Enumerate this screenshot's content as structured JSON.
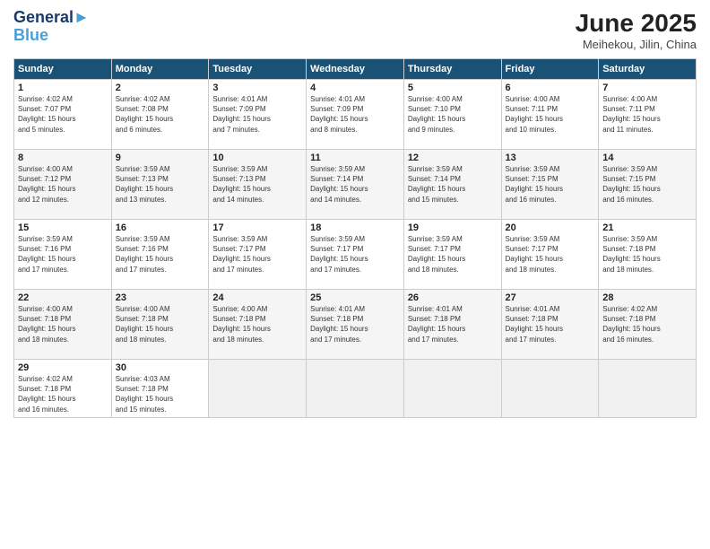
{
  "header": {
    "logo_line1": "General",
    "logo_line2": "Blue",
    "month": "June 2025",
    "location": "Meihekou, Jilin, China"
  },
  "weekdays": [
    "Sunday",
    "Monday",
    "Tuesday",
    "Wednesday",
    "Thursday",
    "Friday",
    "Saturday"
  ],
  "weeks": [
    [
      {
        "day": "1",
        "info": "Sunrise: 4:02 AM\nSunset: 7:07 PM\nDaylight: 15 hours\nand 5 minutes."
      },
      {
        "day": "2",
        "info": "Sunrise: 4:02 AM\nSunset: 7:08 PM\nDaylight: 15 hours\nand 6 minutes."
      },
      {
        "day": "3",
        "info": "Sunrise: 4:01 AM\nSunset: 7:09 PM\nDaylight: 15 hours\nand 7 minutes."
      },
      {
        "day": "4",
        "info": "Sunrise: 4:01 AM\nSunset: 7:09 PM\nDaylight: 15 hours\nand 8 minutes."
      },
      {
        "day": "5",
        "info": "Sunrise: 4:00 AM\nSunset: 7:10 PM\nDaylight: 15 hours\nand 9 minutes."
      },
      {
        "day": "6",
        "info": "Sunrise: 4:00 AM\nSunset: 7:11 PM\nDaylight: 15 hours\nand 10 minutes."
      },
      {
        "day": "7",
        "info": "Sunrise: 4:00 AM\nSunset: 7:11 PM\nDaylight: 15 hours\nand 11 minutes."
      }
    ],
    [
      {
        "day": "8",
        "info": "Sunrise: 4:00 AM\nSunset: 7:12 PM\nDaylight: 15 hours\nand 12 minutes."
      },
      {
        "day": "9",
        "info": "Sunrise: 3:59 AM\nSunset: 7:13 PM\nDaylight: 15 hours\nand 13 minutes."
      },
      {
        "day": "10",
        "info": "Sunrise: 3:59 AM\nSunset: 7:13 PM\nDaylight: 15 hours\nand 14 minutes."
      },
      {
        "day": "11",
        "info": "Sunrise: 3:59 AM\nSunset: 7:14 PM\nDaylight: 15 hours\nand 14 minutes."
      },
      {
        "day": "12",
        "info": "Sunrise: 3:59 AM\nSunset: 7:14 PM\nDaylight: 15 hours\nand 15 minutes."
      },
      {
        "day": "13",
        "info": "Sunrise: 3:59 AM\nSunset: 7:15 PM\nDaylight: 15 hours\nand 16 minutes."
      },
      {
        "day": "14",
        "info": "Sunrise: 3:59 AM\nSunset: 7:15 PM\nDaylight: 15 hours\nand 16 minutes."
      }
    ],
    [
      {
        "day": "15",
        "info": "Sunrise: 3:59 AM\nSunset: 7:16 PM\nDaylight: 15 hours\nand 17 minutes."
      },
      {
        "day": "16",
        "info": "Sunrise: 3:59 AM\nSunset: 7:16 PM\nDaylight: 15 hours\nand 17 minutes."
      },
      {
        "day": "17",
        "info": "Sunrise: 3:59 AM\nSunset: 7:17 PM\nDaylight: 15 hours\nand 17 minutes."
      },
      {
        "day": "18",
        "info": "Sunrise: 3:59 AM\nSunset: 7:17 PM\nDaylight: 15 hours\nand 17 minutes."
      },
      {
        "day": "19",
        "info": "Sunrise: 3:59 AM\nSunset: 7:17 PM\nDaylight: 15 hours\nand 18 minutes."
      },
      {
        "day": "20",
        "info": "Sunrise: 3:59 AM\nSunset: 7:17 PM\nDaylight: 15 hours\nand 18 minutes."
      },
      {
        "day": "21",
        "info": "Sunrise: 3:59 AM\nSunset: 7:18 PM\nDaylight: 15 hours\nand 18 minutes."
      }
    ],
    [
      {
        "day": "22",
        "info": "Sunrise: 4:00 AM\nSunset: 7:18 PM\nDaylight: 15 hours\nand 18 minutes."
      },
      {
        "day": "23",
        "info": "Sunrise: 4:00 AM\nSunset: 7:18 PM\nDaylight: 15 hours\nand 18 minutes."
      },
      {
        "day": "24",
        "info": "Sunrise: 4:00 AM\nSunset: 7:18 PM\nDaylight: 15 hours\nand 18 minutes."
      },
      {
        "day": "25",
        "info": "Sunrise: 4:01 AM\nSunset: 7:18 PM\nDaylight: 15 hours\nand 17 minutes."
      },
      {
        "day": "26",
        "info": "Sunrise: 4:01 AM\nSunset: 7:18 PM\nDaylight: 15 hours\nand 17 minutes."
      },
      {
        "day": "27",
        "info": "Sunrise: 4:01 AM\nSunset: 7:18 PM\nDaylight: 15 hours\nand 17 minutes."
      },
      {
        "day": "28",
        "info": "Sunrise: 4:02 AM\nSunset: 7:18 PM\nDaylight: 15 hours\nand 16 minutes."
      }
    ],
    [
      {
        "day": "29",
        "info": "Sunrise: 4:02 AM\nSunset: 7:18 PM\nDaylight: 15 hours\nand 16 minutes."
      },
      {
        "day": "30",
        "info": "Sunrise: 4:03 AM\nSunset: 7:18 PM\nDaylight: 15 hours\nand 15 minutes."
      },
      {
        "day": "",
        "info": ""
      },
      {
        "day": "",
        "info": ""
      },
      {
        "day": "",
        "info": ""
      },
      {
        "day": "",
        "info": ""
      },
      {
        "day": "",
        "info": ""
      }
    ]
  ]
}
